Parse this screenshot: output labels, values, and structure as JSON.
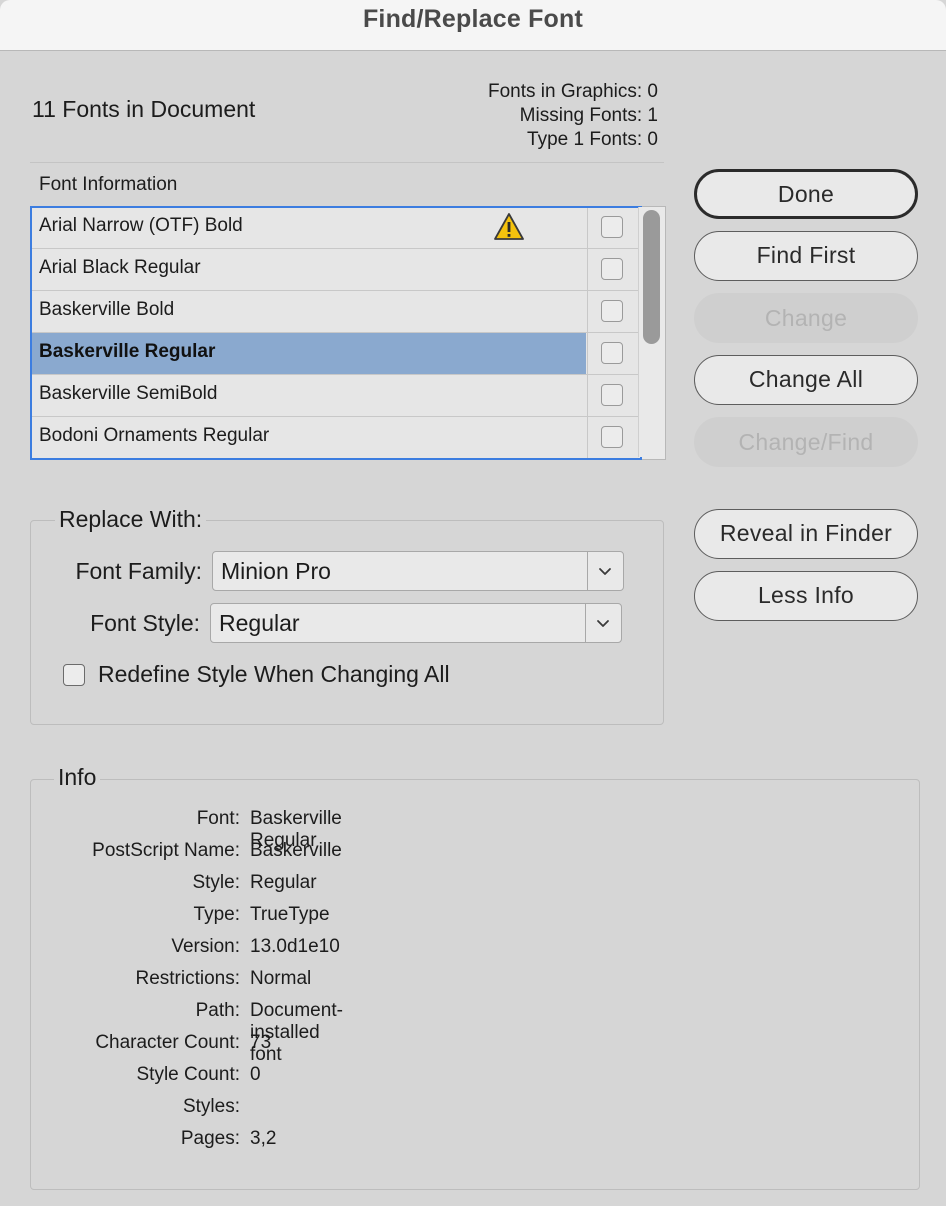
{
  "window": {
    "title": "Find/Replace Font"
  },
  "summary": {
    "fonts_in_document": "11 Fonts in Document",
    "fonts_in_graphics": "Fonts in Graphics: 0",
    "missing_fonts": "Missing Fonts: 1",
    "type1_fonts": "Type 1 Fonts: 0"
  },
  "font_list": {
    "header": "Font Information",
    "selected_index": 3,
    "rows": [
      {
        "name": "Arial Narrow (OTF) Bold",
        "warning": true,
        "checked": false
      },
      {
        "name": "Arial Black Regular",
        "warning": false,
        "checked": false
      },
      {
        "name": "Baskerville Bold",
        "warning": false,
        "checked": false
      },
      {
        "name": "Baskerville Regular",
        "warning": false,
        "checked": false
      },
      {
        "name": "Baskerville SemiBold",
        "warning": false,
        "checked": false
      },
      {
        "name": "Bodoni Ornaments Regular",
        "warning": false,
        "checked": false
      }
    ]
  },
  "buttons": {
    "done": "Done",
    "find_first": "Find First",
    "change": "Change",
    "change_all": "Change All",
    "change_find": "Change/Find",
    "reveal_in_finder": "Reveal in Finder",
    "less_info": "Less Info"
  },
  "replace_with": {
    "legend": "Replace With:",
    "font_family_label": "Font Family:",
    "font_family_value": "Minion Pro",
    "font_style_label": "Font Style:",
    "font_style_value": "Regular",
    "redefine_label": "Redefine Style When Changing All",
    "redefine_checked": false
  },
  "info": {
    "legend": "Info",
    "fields": [
      {
        "key": "Font:",
        "value": "Baskerville Regular"
      },
      {
        "key": "PostScript Name:",
        "value": "Baskerville"
      },
      {
        "key": "Style:",
        "value": "Regular"
      },
      {
        "key": "Type:",
        "value": "TrueType"
      },
      {
        "key": "Version:",
        "value": "13.0d1e10"
      },
      {
        "key": "Restrictions:",
        "value": "Normal"
      },
      {
        "key": "Path:",
        "value": "Document-installed font"
      },
      {
        "key": "Character Count:",
        "value": "73"
      },
      {
        "key": "Style Count:",
        "value": "0"
      },
      {
        "key": "Styles:",
        "value": ""
      },
      {
        "key": "Pages:",
        "value": "3,2"
      }
    ]
  },
  "colors": {
    "selection": "#8aa9cf",
    "focus_ring": "#3c7de0",
    "warning": "#f4c20d"
  },
  "icons": {
    "warning": "warning-triangle-icon",
    "dropdown": "chevron-down-icon"
  }
}
